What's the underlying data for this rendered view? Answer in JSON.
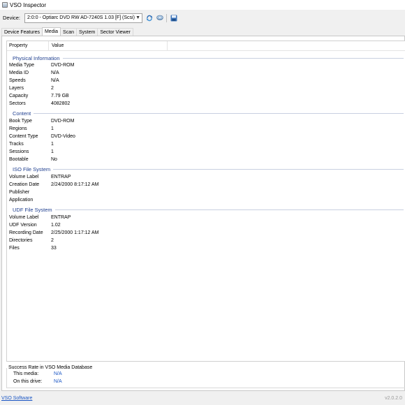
{
  "window": {
    "title": "VSO Inspector"
  },
  "device_bar": {
    "label": "Device:",
    "selected_device": "2:0:0 - Optiarc DVD RW AD-7240S 1.03 [F] (Scsi)"
  },
  "tabs": [
    {
      "label": "Device Features",
      "active": false
    },
    {
      "label": "Media",
      "active": true
    },
    {
      "label": "Scan",
      "active": false
    },
    {
      "label": "System",
      "active": false
    },
    {
      "label": "Sector Viewer",
      "active": false
    }
  ],
  "table": {
    "headers": [
      "Property",
      "Value"
    ],
    "groups": [
      {
        "title": "Physical Information",
        "rows": [
          [
            "Media Type",
            "DVD-ROM"
          ],
          [
            "Media ID",
            "N/A"
          ],
          [
            "Speeds",
            "N/A"
          ],
          [
            "Layers",
            "2"
          ],
          [
            "Capacity",
            "7.79 GB"
          ],
          [
            "Sectors",
            "4082802"
          ]
        ]
      },
      {
        "title": "Content",
        "rows": [
          [
            "Book Type",
            "DVD-ROM"
          ],
          [
            "Regions",
            "1"
          ],
          [
            "Content Type",
            "DVD-Video"
          ],
          [
            "Tracks",
            "1"
          ],
          [
            "Sessions",
            "1"
          ],
          [
            "Bootable",
            "No"
          ]
        ]
      },
      {
        "title": "ISO File System",
        "rows": [
          [
            "Volume Label",
            "ENTRAP"
          ],
          [
            "Creation Date",
            "2/24/2000 8:17:12 AM"
          ],
          [
            "Publisher",
            ""
          ],
          [
            "Application",
            ""
          ]
        ]
      },
      {
        "title": "UDF File System",
        "rows": [
          [
            "Volume Label",
            "ENTRAP"
          ],
          [
            "UDF Version",
            "1.02"
          ],
          [
            "Recording Date",
            "2/25/2000 1:17:12 AM"
          ],
          [
            "Directories",
            "2"
          ],
          [
            "Files",
            "33"
          ]
        ]
      }
    ]
  },
  "success_rate": {
    "title": "Success Rate in VSO Media Database",
    "rows": [
      {
        "label": "This media:",
        "value": "N/A"
      },
      {
        "label": "On this drive:",
        "value": "N/A"
      }
    ]
  },
  "status_bar": {
    "link": "VSO Software",
    "version": "v2.0.2.0"
  },
  "colors": {
    "group_title": "#1f3f8f",
    "link": "#1a56c4",
    "window_bg": "#f0f0f0"
  },
  "icons": [
    "app-icon",
    "refresh-icon",
    "eject-icon",
    "save-icon"
  ]
}
